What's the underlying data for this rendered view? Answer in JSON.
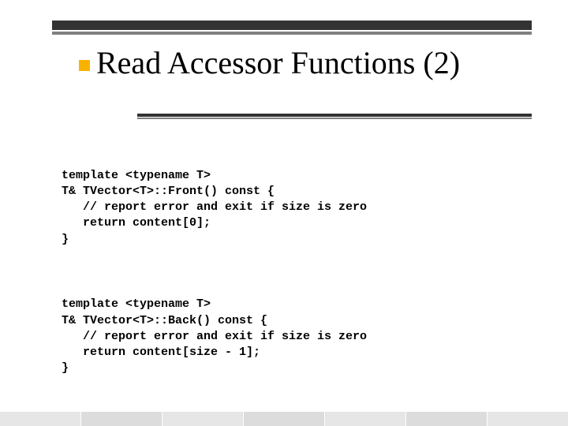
{
  "title": "Read Accessor Functions (2)",
  "code": {
    "block1": "template <typename T>\nT& TVector<T>::Front() const {\n   // report error and exit if size is zero\n   return content[0];\n}",
    "block2": "template <typename T>\nT& TVector<T>::Back() const {\n   // report error and exit if size is zero\n   return content[size - 1];\n}"
  }
}
